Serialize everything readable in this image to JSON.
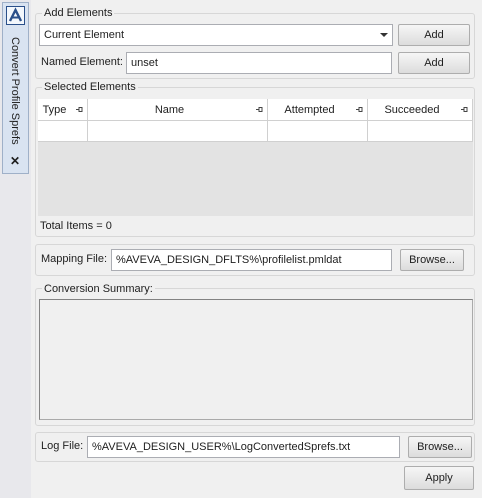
{
  "side_tab": {
    "title": "Convert Profile Sprefs",
    "icon": "aveva-logo-icon",
    "close_glyph": "✕"
  },
  "add_elements": {
    "title": "Add Elements",
    "current_element": {
      "value": "Current Element",
      "add_label": "Add"
    },
    "named_element": {
      "label": "Named Element:",
      "value": "unset",
      "add_label": "Add"
    }
  },
  "selected_elements": {
    "title": "Selected Elements",
    "columns": [
      "Type",
      "Name",
      "Attempted",
      "Succeeded"
    ],
    "rows": [
      [
        "",
        "",
        "",
        ""
      ]
    ],
    "total_label": "Total Items = 0"
  },
  "mapping": {
    "label": "Mapping File:",
    "value": "%AVEVA_DESIGN_DFLTS%\\profilelist.pmldat",
    "browse_label": "Browse..."
  },
  "summary": {
    "title": "Conversion Summary:",
    "text": ""
  },
  "log": {
    "label": "Log File:",
    "value": "%AVEVA_DESIGN_USER%\\LogConvertedSprefs.txt",
    "browse_label": "Browse..."
  },
  "apply_label": "Apply",
  "colors": {
    "panel": "#f0f0f0",
    "tab_strip": "#d9e3f1",
    "icon_blue": "#2a4f8a",
    "grid_empty": "#e3e3e3"
  }
}
